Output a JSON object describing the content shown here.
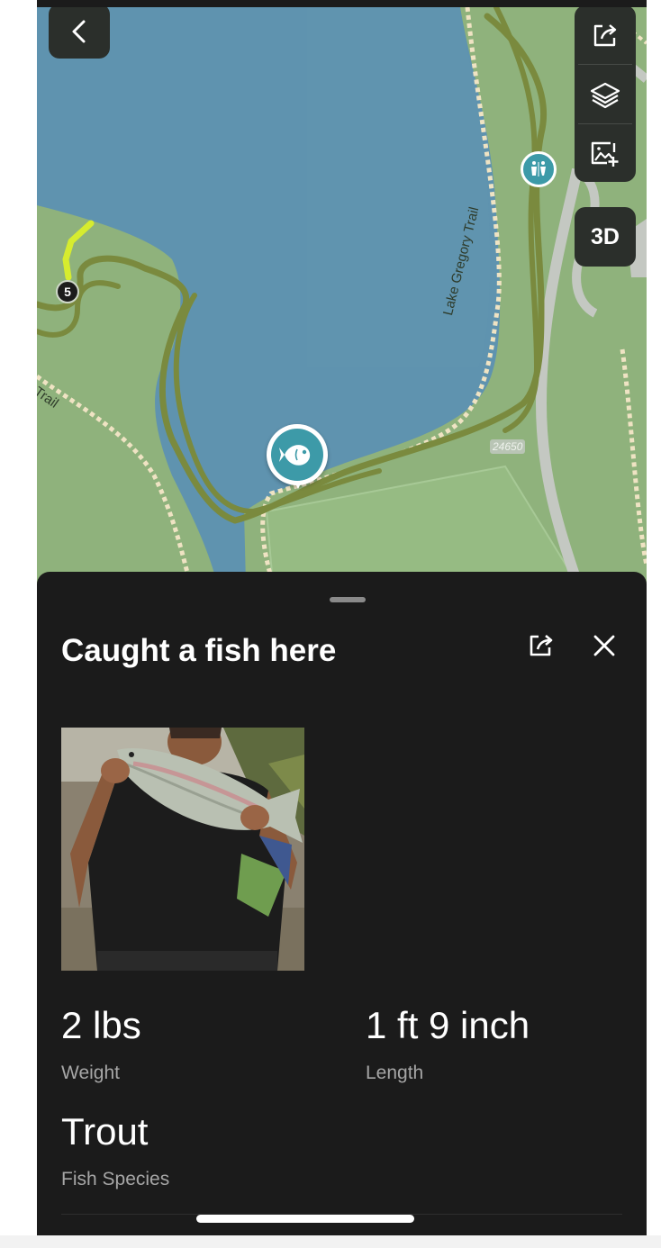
{
  "map": {
    "trail_label": "Lake Gregory Trail",
    "trail_label_left": "Trail",
    "road_number": "24650",
    "waypoint_number": "5"
  },
  "toolbar": {
    "three_d_label": "3D"
  },
  "sheet": {
    "title": "Caught a fish here"
  },
  "stats": [
    {
      "value": "2 lbs",
      "label": "Weight"
    },
    {
      "value": "1 ft 9 inch",
      "label": "Length"
    },
    {
      "value": "Trout",
      "label": "Fish Species"
    }
  ],
  "colors": {
    "water": "#5f93af",
    "land": "#8fb27c",
    "trail": "#7a8a3e",
    "highlight": "#d6ec2f",
    "marker": "#3d9aa8",
    "sheet_bg": "#1b1b1b"
  }
}
